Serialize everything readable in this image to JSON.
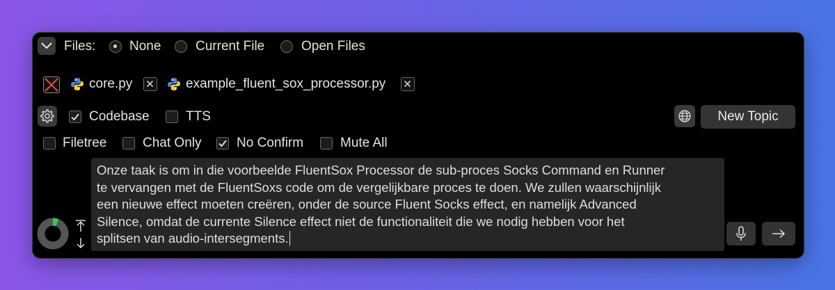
{
  "files": {
    "label": "Files:",
    "options": [
      "None",
      "Current File",
      "Open Files"
    ],
    "selected": "None"
  },
  "open_files": [
    {
      "name": "core.py",
      "icon": "python-icon"
    },
    {
      "name": "example_fluent_sox_processor.py",
      "icon": "python-icon"
    }
  ],
  "options_row1": {
    "codebase": {
      "label": "Codebase",
      "checked": true
    },
    "tts": {
      "label": "TTS",
      "checked": false
    }
  },
  "options_row2": {
    "filetree": {
      "label": "Filetree",
      "checked": false
    },
    "chat_only": {
      "label": "Chat Only",
      "checked": false
    },
    "no_confirm": {
      "label": "No Confirm",
      "checked": true
    },
    "mute_all": {
      "label": "Mute All",
      "checked": false
    }
  },
  "new_topic_label": "New Topic",
  "prompt": {
    "lines": [
      "Onze taak is om in die voorbeelde FluentSox Processor de sub-proces Socks Command en Runner",
      "te vervangen met de FluentSoxs code om de vergelijkbare proces te doen. We zullen waarschijnlijk",
      "een nieuwe effect moeten creëren, onder de source Fluent Socks effect, en namelijk Advanced",
      "Silence, omdat de currente Silence effect niet de functionaliteit die we nodig hebben voor het",
      "splitsen van audio-intersegments."
    ]
  },
  "context_usage_fraction": 0.06,
  "colors": {
    "accent_green": "#35c759",
    "danger_red": "#e5484d",
    "panel": "#000000",
    "input_bg": "#262626"
  },
  "icons": {
    "collapse": "chevron-down-icon",
    "clear_files": "clear-files-icon",
    "settings": "gear-icon",
    "language": "globe-icon",
    "expand": "expand-arrows-icon",
    "mic": "microphone-icon",
    "send": "arrow-right-icon"
  }
}
